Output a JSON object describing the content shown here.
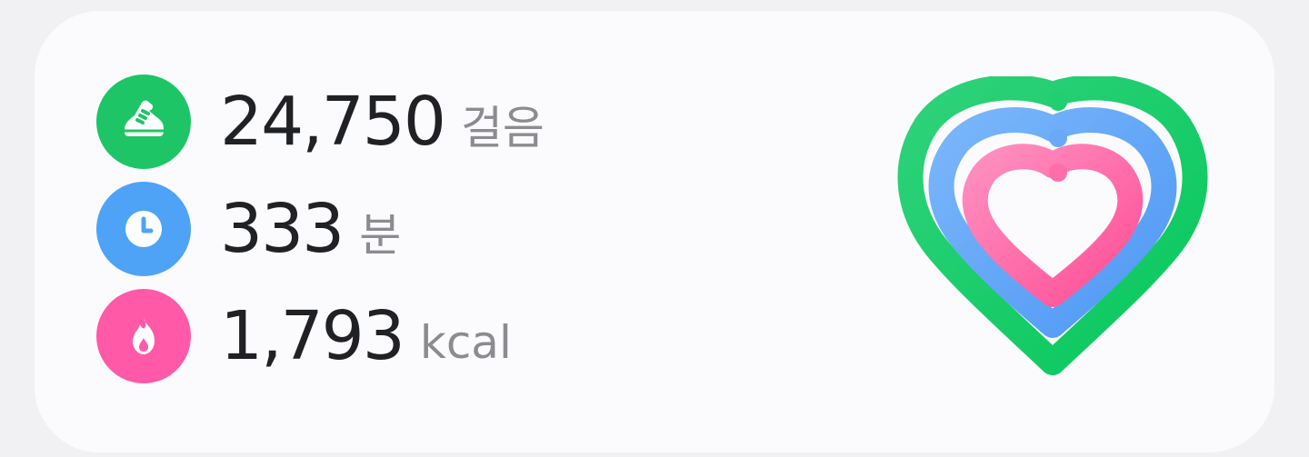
{
  "activity": {
    "steps": {
      "value": "24,750",
      "unit": "걸음",
      "icon": "shoe-icon",
      "color": "#1dc566"
    },
    "active_time": {
      "value": "333",
      "unit": "분",
      "icon": "clock-icon",
      "color": "#4ea3f7"
    },
    "calories": {
      "value": "1,793",
      "unit": "kcal",
      "icon": "flame-icon",
      "color": "#ff59a8"
    }
  },
  "rings": {
    "outer_color": "#1ccb67",
    "middle_color": "#5aa2f7",
    "inner_color": "#ff5ea4"
  }
}
